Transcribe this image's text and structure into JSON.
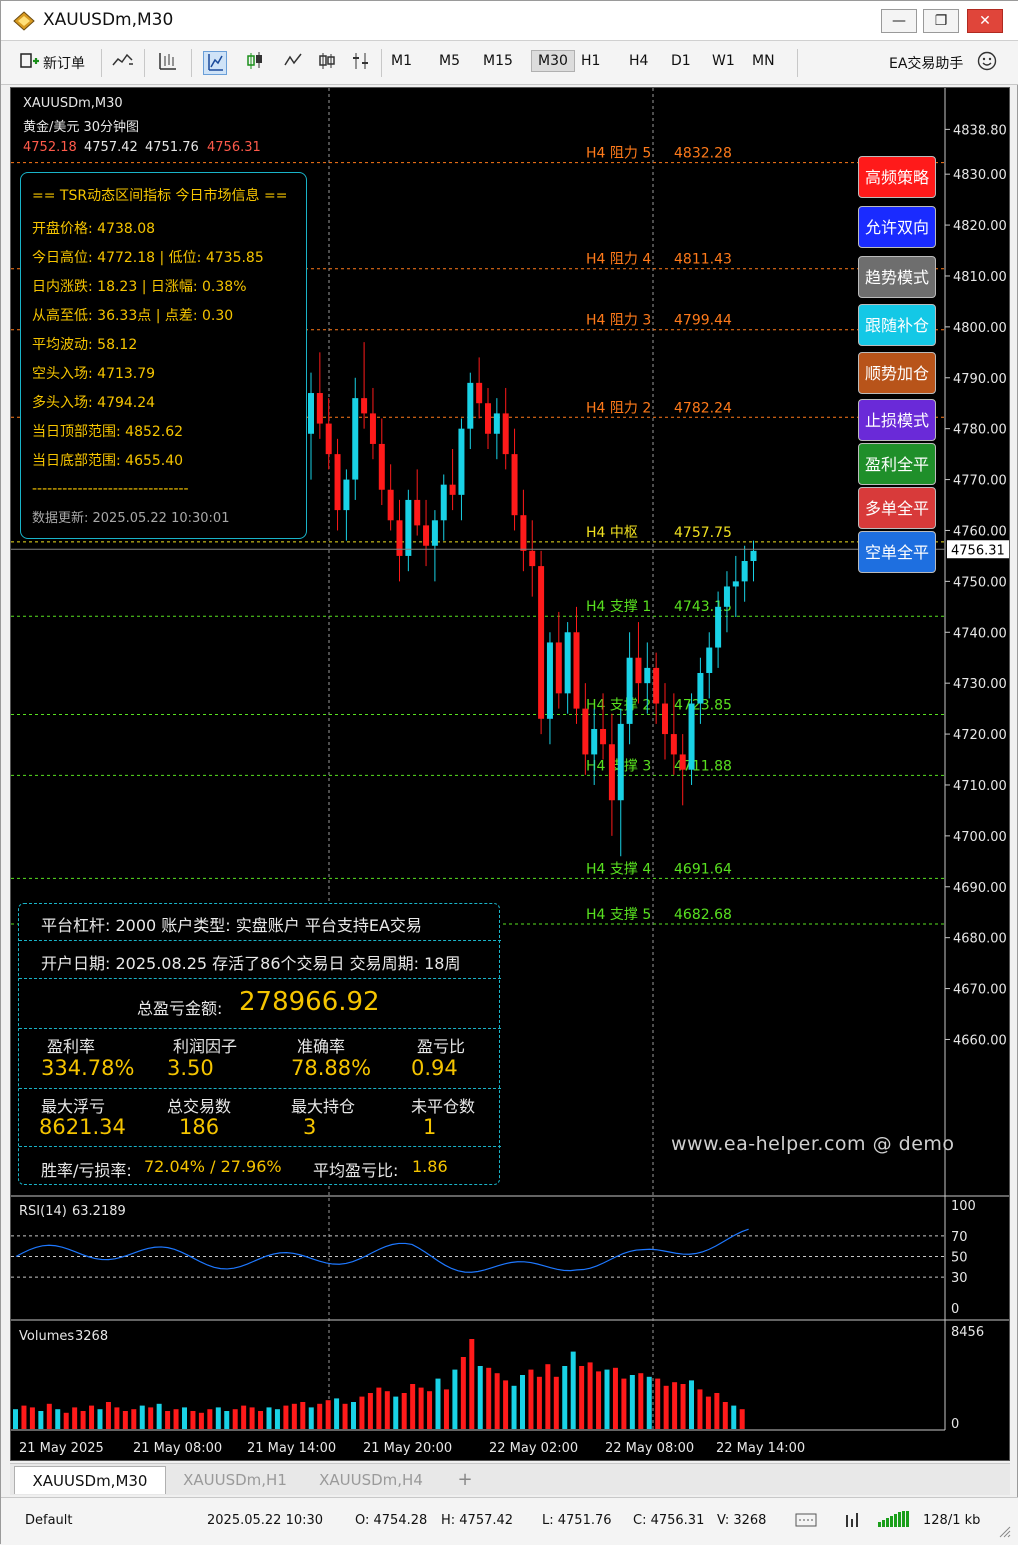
{
  "window": {
    "title": "XAUUSDm,M30",
    "minimize": "—",
    "maximize": "❐",
    "close": "✕"
  },
  "toolbar": {
    "new_order": "新订单",
    "timeframes": [
      "M1",
      "M5",
      "M15",
      "M30",
      "H1",
      "H4",
      "D1",
      "W1",
      "MN"
    ],
    "active_timeframe": "M30",
    "ea_assistant": "EA交易助手"
  },
  "chart_header": {
    "symbol": "XAUUSDm,M30",
    "subtitle": "黄金/美元  30分钟图",
    "ohlc": [
      "4752.18",
      "4757.42",
      "4751.76",
      "4756.31"
    ]
  },
  "info_panel": {
    "lines": [
      "== TSR动态区间指标  今日市场信息 ==",
      "开盘价格: 4738.08",
      "今日高位: 4772.18 | 低位: 4735.85",
      "日内涨跌: 18.23 | 日涨幅: 0.38%",
      "从高至低: 36.33点 | 点差: 0.30",
      "平均波动: 58.12",
      "空头入场: 4713.79",
      "多头入场: 4794.24",
      "当日顶部范围: 4852.62",
      "当日底部范围: 4655.40",
      "-------------------------------",
      "数据更新: 2025.05.22 10:30:01"
    ]
  },
  "stats_panel": {
    "row1": "平台杠杆: 2000   账户类型: 实盘账户   平台支持EA交易",
    "row2": "开户日期: 2025.08.25   存活了86个交易日   交易周期: 18周",
    "total_label": "总盈亏金额:",
    "total_value": "278966.92",
    "grid1_labels": [
      "盈利率",
      "利润因子",
      "准确率",
      "盈亏比"
    ],
    "grid1_values": [
      "334.78%",
      "3.50",
      "78.88%",
      "0.94"
    ],
    "grid2_labels": [
      "最大浮亏",
      "总交易数",
      "最大持仓",
      "未平仓数"
    ],
    "grid2_values": [
      "8621.34",
      "186",
      "3",
      "1"
    ],
    "winrate_label": "胜率/亏损率:",
    "winrate_value": "72.04% / 27.96%",
    "avg_label": "平均盈亏比:",
    "avg_value": "1.86"
  },
  "side_buttons": [
    {
      "label": "高频策略",
      "color": "#ff1a1a"
    },
    {
      "label": "允许双向",
      "color": "#1a2bff"
    },
    {
      "label": "趋势模式",
      "color": "#6e6e6e"
    },
    {
      "label": "跟随补仓",
      "color": "#14c8e6"
    },
    {
      "label": "顺势加仓",
      "color": "#b8541a"
    },
    {
      "label": "止损模式",
      "color": "#6a2ad8"
    },
    {
      "label": "盈利全平",
      "color": "#1f8f2a"
    },
    {
      "label": "多单全平",
      "color": "#d83a3a"
    },
    {
      "label": "空单全平",
      "color": "#1e6fe0"
    }
  ],
  "watermark": "www.ea-helper.com @ demo",
  "levels": [
    {
      "label": "H4 阻力 5",
      "value": "4832.28",
      "color": "#ff7a1a"
    },
    {
      "label": "H4 阻力 4",
      "value": "4811.43",
      "color": "#ff7a1a"
    },
    {
      "label": "H4 阻力 3",
      "value": "4799.44",
      "color": "#ff7a1a"
    },
    {
      "label": "H4 阻力 2",
      "value": "4782.24",
      "color": "#ff7a1a"
    },
    {
      "label": "H4 中枢",
      "value": "4757.75",
      "color": "#f0e020"
    },
    {
      "label": "H4 支撑 1",
      "value": "4743.15",
      "color": "#58e020"
    },
    {
      "label": "H4 支撑 2",
      "value": "4723.85",
      "color": "#58e020"
    },
    {
      "label": "H4 支撑 3",
      "value": "4711.88",
      "color": "#58e020"
    },
    {
      "label": "H4 支撑 4",
      "value": "4691.64",
      "color": "#58e020"
    },
    {
      "label": "H4 支撑 5",
      "value": "4682.68",
      "color": "#58e020"
    }
  ],
  "price_axis": {
    "labels": [
      "4838.80",
      "4830.00",
      "4820.00",
      "4810.00",
      "4800.00",
      "4790.00",
      "4780.00",
      "4770.00",
      "4760.00",
      "4750.00",
      "4740.00",
      "4730.00",
      "4720.00",
      "4710.00",
      "4700.00",
      "4690.00",
      "4680.00",
      "4670.00",
      "4660.00"
    ],
    "current": "4756.31"
  },
  "rsi": {
    "label": "RSI(14)",
    "value": "63.2189",
    "levels": [
      "100",
      "70",
      "50",
      "30",
      "0"
    ]
  },
  "volumes": {
    "label": "Volumes",
    "value": "3268",
    "max": "8456",
    "min": "0"
  },
  "time_axis": [
    "21 May 2025",
    "21 May 08:00",
    "21 May 14:00",
    "21 May 20:00",
    "22 May 02:00",
    "22 May 08:00",
    "22 May 14:00"
  ],
  "tabs": [
    "XAUUSDm,M30",
    "XAUUSDm,H1",
    "XAUUSDm,H4",
    "+"
  ],
  "statusbar": {
    "profile": "Default",
    "datetime": "2025.05.22 10:30",
    "open": "O: 4754.28",
    "high": "H: 4757.42",
    "low": "L: 4751.76",
    "close": "C: 4756.31",
    "volume": "V: 3268",
    "traffic": "128/1 kb"
  },
  "chart_data": {
    "type": "candlestick",
    "price_range": [
      4651,
      4843
    ],
    "candles": [
      [
        4779,
        4791,
        4770,
        4787
      ],
      [
        4787,
        4795,
        4778,
        4781
      ],
      [
        4781,
        4786,
        4772,
        4775
      ],
      [
        4775,
        4778,
        4760,
        4764
      ],
      [
        4764,
        4772,
        4758,
        4770
      ],
      [
        4770,
        4790,
        4766,
        4786
      ],
      [
        4786,
        4797,
        4780,
        4783
      ],
      [
        4783,
        4788,
        4774,
        4777
      ],
      [
        4777,
        4782,
        4765,
        4768
      ],
      [
        4768,
        4773,
        4760,
        4762
      ],
      [
        4762,
        4766,
        4750,
        4755
      ],
      [
        4755,
        4768,
        4752,
        4766
      ],
      [
        4766,
        4772,
        4759,
        4761
      ],
      [
        4761,
        4766,
        4753,
        4757
      ],
      [
        4757,
        4764,
        4750,
        4762
      ],
      [
        4762,
        4771,
        4758,
        4769
      ],
      [
        4769,
        4776,
        4764,
        4767
      ],
      [
        4767,
        4782,
        4762,
        4780
      ],
      [
        4780,
        4791,
        4776,
        4789
      ],
      [
        4789,
        4794,
        4782,
        4785
      ],
      [
        4785,
        4788,
        4776,
        4779
      ],
      [
        4779,
        4786,
        4774,
        4783
      ],
      [
        4783,
        4788,
        4772,
        4775
      ],
      [
        4775,
        4780,
        4760,
        4763
      ],
      [
        4763,
        4768,
        4752,
        4756
      ],
      [
        4756,
        4762,
        4747,
        4753
      ],
      [
        4753,
        4756,
        4720,
        4723
      ],
      [
        4723,
        4740,
        4718,
        4738
      ],
      [
        4738,
        4744,
        4725,
        4728
      ],
      [
        4728,
        4742,
        4724,
        4740
      ],
      [
        4740,
        4745,
        4722,
        4725
      ],
      [
        4725,
        4730,
        4712,
        4716
      ],
      [
        4716,
        4725,
        4710,
        4721
      ],
      [
        4721,
        4728,
        4715,
        4718
      ],
      [
        4718,
        4724,
        4700,
        4707
      ],
      [
        4707,
        4725,
        4696,
        4722
      ],
      [
        4722,
        4740,
        4718,
        4735
      ],
      [
        4735,
        4742,
        4726,
        4730
      ],
      [
        4730,
        4738,
        4724,
        4733
      ],
      [
        4733,
        4736,
        4722,
        4726
      ],
      [
        4726,
        4730,
        4715,
        4720
      ],
      [
        4720,
        4728,
        4712,
        4716
      ],
      [
        4716,
        4720,
        4706,
        4713
      ],
      [
        4713,
        4728,
        4710,
        4726
      ],
      [
        4726,
        4735,
        4722,
        4732
      ],
      [
        4732,
        4740,
        4727,
        4737
      ],
      [
        4737,
        4748,
        4733,
        4745
      ],
      [
        4745,
        4752,
        4740,
        4749
      ],
      [
        4749,
        4755,
        4743,
        4750
      ],
      [
        4750,
        4757,
        4746,
        4754
      ],
      [
        4754,
        4758,
        4750,
        4756
      ]
    ]
  }
}
